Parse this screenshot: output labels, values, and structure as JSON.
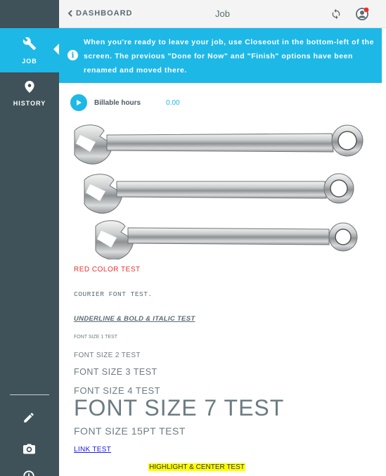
{
  "sidebar": {
    "items": [
      {
        "label": "JOB",
        "icon": "wrench-icon"
      },
      {
        "label": "HISTORY",
        "icon": "map-pin-icon"
      }
    ],
    "tools": [
      "pencil-icon",
      "camera-icon",
      "clock-icon"
    ]
  },
  "header": {
    "back_label": "DASHBOARD",
    "title": "Job"
  },
  "banner": {
    "message": "When you're ready to leave your job, use Closeout in the bottom-left of the screen. The previous \"Done for Now\" and \"Finish\" options have been renamed and moved there."
  },
  "billable": {
    "label": "Billable hours",
    "value": "0.00"
  },
  "content": {
    "image": "wrench-set-photo",
    "red_test": "RED COLOR TEST",
    "courier_test": "COURIER FONT TEST.",
    "ubi_test": "UNDERLINE & BOLD & ITALIC TEST",
    "fs1": "FONT SIZE 1 TEST",
    "fs2": "FONT SIZE 2 TEST",
    "fs3": "FONT SIZE 3 TEST",
    "fs4": "FONT SIZE 4 TEST",
    "fs7": "FONT SIZE 7 TEST",
    "fs15": "FONT SIZE 15PT TEST",
    "link_test": "LINK TEST",
    "highlight_test": "HIGHLIGHT & CENTER TEST"
  },
  "colors": {
    "accent": "#1eb8e6",
    "sidebar": "#3f5159",
    "red": "#e8302e",
    "link": "#1a1aee",
    "highlight": "#ffff00",
    "notification": "#e8302e"
  }
}
